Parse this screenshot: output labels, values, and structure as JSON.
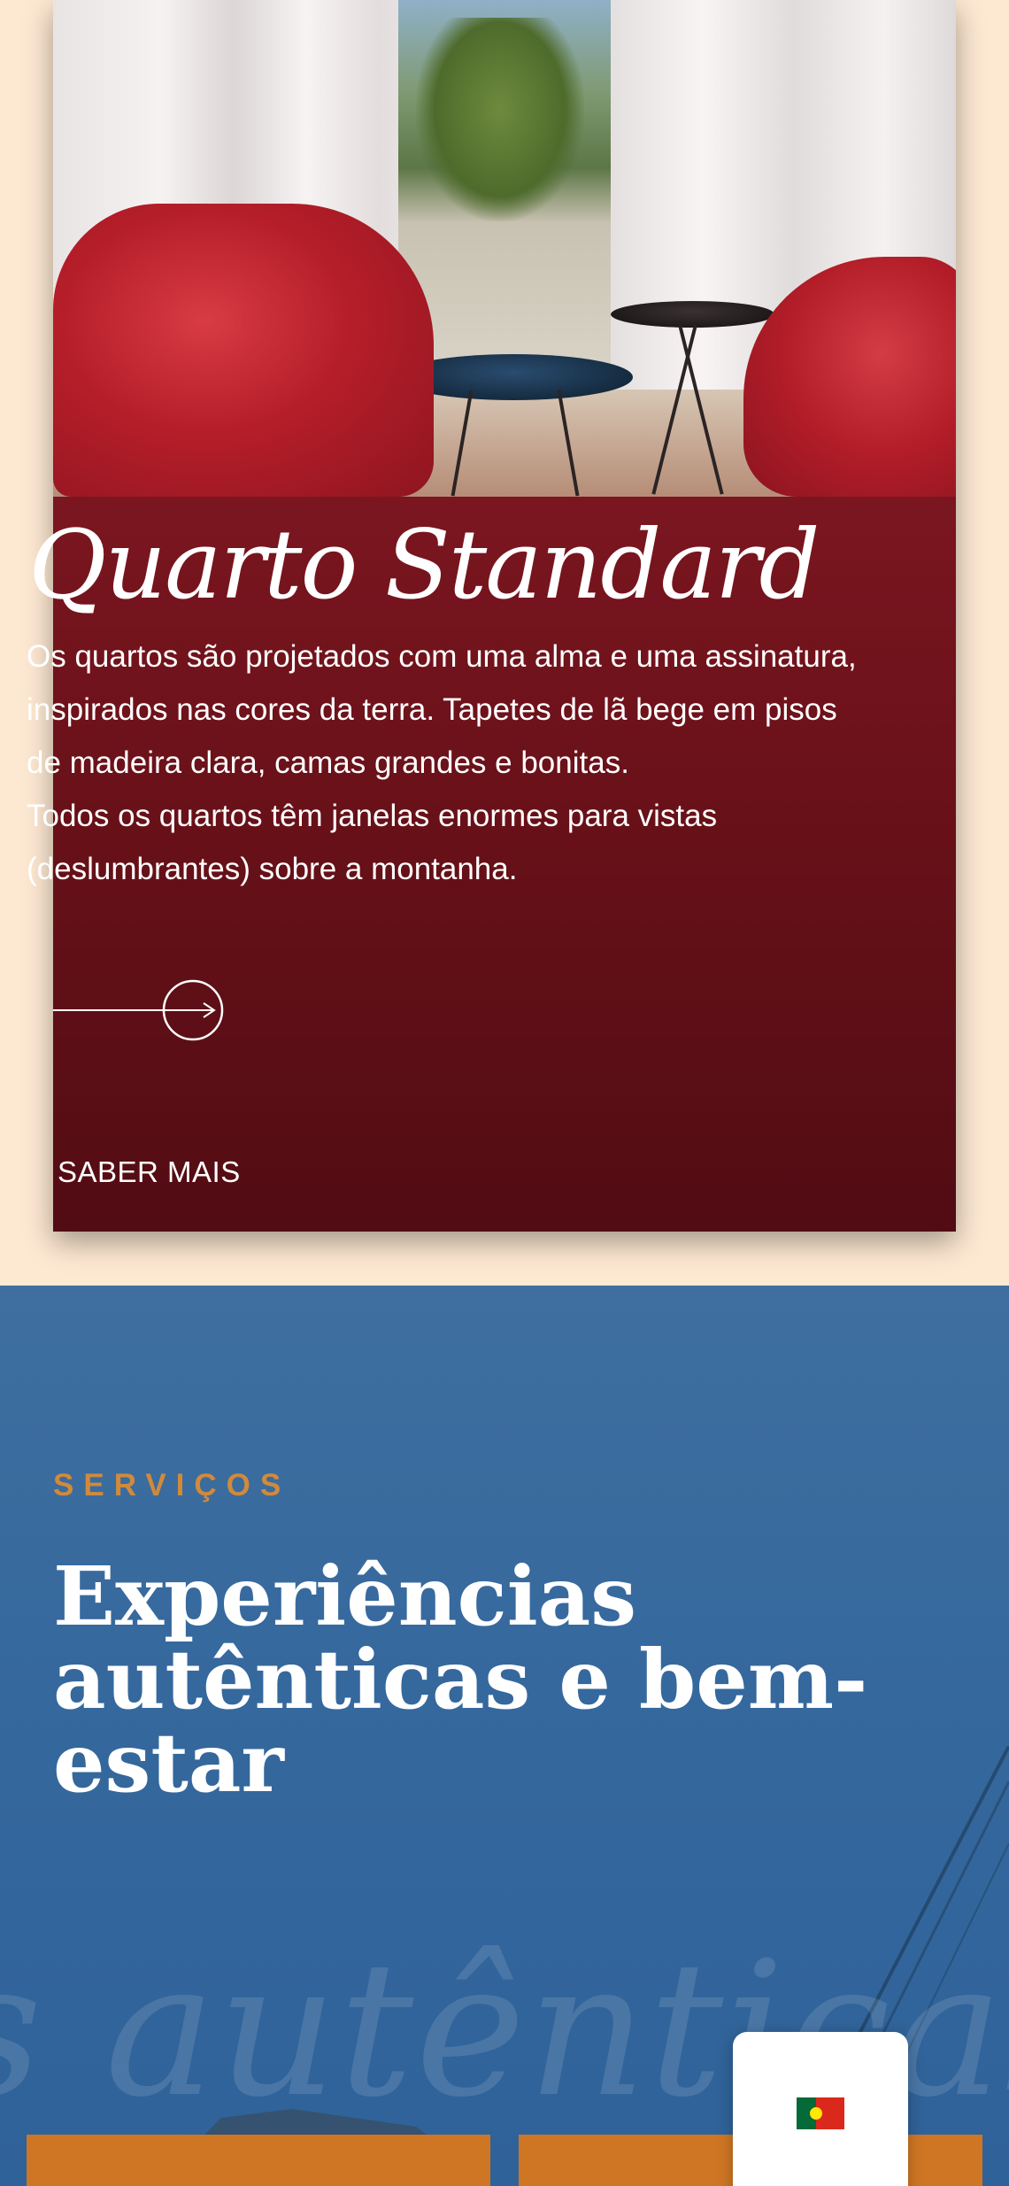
{
  "room": {
    "title": "Quarto Standard",
    "description": [
      "Os quartos são projetados com uma alma e uma assinatura, inspirados nas cores da terra. Tapetes de lã bege em pisos de madeira clara, camas grandes e bonitas.",
      "Todos os quartos têm janelas enormes para vistas (deslumbrantes) sobre a montanha."
    ],
    "arrow_icon": "arrow-right-circle-icon",
    "cta_label": "SABER MAIS"
  },
  "services": {
    "eyebrow": "SERVIÇOS",
    "heading": "Experiências autênticas e bem-estar",
    "watermark": "s autênticas e"
  },
  "language": {
    "current": "pt",
    "flag_icon": "portugal-flag-icon"
  },
  "colors": {
    "page_bg": "#fde8d2",
    "room_overlay": "#6a1119",
    "services_bg": "#35689d",
    "accent_orange": "#d18a3b",
    "service_card": "#cf7624"
  }
}
